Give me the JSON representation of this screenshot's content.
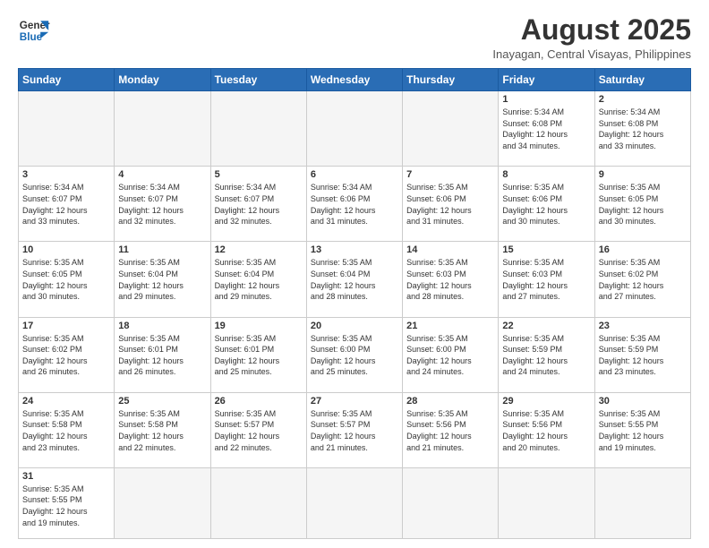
{
  "header": {
    "logo_general": "General",
    "logo_blue": "Blue",
    "month_year": "August 2025",
    "location": "Inayagan, Central Visayas, Philippines"
  },
  "weekdays": [
    "Sunday",
    "Monday",
    "Tuesday",
    "Wednesday",
    "Thursday",
    "Friday",
    "Saturday"
  ],
  "weeks": [
    [
      {
        "day": "",
        "info": ""
      },
      {
        "day": "",
        "info": ""
      },
      {
        "day": "",
        "info": ""
      },
      {
        "day": "",
        "info": ""
      },
      {
        "day": "",
        "info": ""
      },
      {
        "day": "1",
        "info": "Sunrise: 5:34 AM\nSunset: 6:08 PM\nDaylight: 12 hours\nand 34 minutes."
      },
      {
        "day": "2",
        "info": "Sunrise: 5:34 AM\nSunset: 6:08 PM\nDaylight: 12 hours\nand 33 minutes."
      }
    ],
    [
      {
        "day": "3",
        "info": "Sunrise: 5:34 AM\nSunset: 6:07 PM\nDaylight: 12 hours\nand 33 minutes."
      },
      {
        "day": "4",
        "info": "Sunrise: 5:34 AM\nSunset: 6:07 PM\nDaylight: 12 hours\nand 32 minutes."
      },
      {
        "day": "5",
        "info": "Sunrise: 5:34 AM\nSunset: 6:07 PM\nDaylight: 12 hours\nand 32 minutes."
      },
      {
        "day": "6",
        "info": "Sunrise: 5:34 AM\nSunset: 6:06 PM\nDaylight: 12 hours\nand 31 minutes."
      },
      {
        "day": "7",
        "info": "Sunrise: 5:35 AM\nSunset: 6:06 PM\nDaylight: 12 hours\nand 31 minutes."
      },
      {
        "day": "8",
        "info": "Sunrise: 5:35 AM\nSunset: 6:06 PM\nDaylight: 12 hours\nand 30 minutes."
      },
      {
        "day": "9",
        "info": "Sunrise: 5:35 AM\nSunset: 6:05 PM\nDaylight: 12 hours\nand 30 minutes."
      }
    ],
    [
      {
        "day": "10",
        "info": "Sunrise: 5:35 AM\nSunset: 6:05 PM\nDaylight: 12 hours\nand 30 minutes."
      },
      {
        "day": "11",
        "info": "Sunrise: 5:35 AM\nSunset: 6:04 PM\nDaylight: 12 hours\nand 29 minutes."
      },
      {
        "day": "12",
        "info": "Sunrise: 5:35 AM\nSunset: 6:04 PM\nDaylight: 12 hours\nand 29 minutes."
      },
      {
        "day": "13",
        "info": "Sunrise: 5:35 AM\nSunset: 6:04 PM\nDaylight: 12 hours\nand 28 minutes."
      },
      {
        "day": "14",
        "info": "Sunrise: 5:35 AM\nSunset: 6:03 PM\nDaylight: 12 hours\nand 28 minutes."
      },
      {
        "day": "15",
        "info": "Sunrise: 5:35 AM\nSunset: 6:03 PM\nDaylight: 12 hours\nand 27 minutes."
      },
      {
        "day": "16",
        "info": "Sunrise: 5:35 AM\nSunset: 6:02 PM\nDaylight: 12 hours\nand 27 minutes."
      }
    ],
    [
      {
        "day": "17",
        "info": "Sunrise: 5:35 AM\nSunset: 6:02 PM\nDaylight: 12 hours\nand 26 minutes."
      },
      {
        "day": "18",
        "info": "Sunrise: 5:35 AM\nSunset: 6:01 PM\nDaylight: 12 hours\nand 26 minutes."
      },
      {
        "day": "19",
        "info": "Sunrise: 5:35 AM\nSunset: 6:01 PM\nDaylight: 12 hours\nand 25 minutes."
      },
      {
        "day": "20",
        "info": "Sunrise: 5:35 AM\nSunset: 6:00 PM\nDaylight: 12 hours\nand 25 minutes."
      },
      {
        "day": "21",
        "info": "Sunrise: 5:35 AM\nSunset: 6:00 PM\nDaylight: 12 hours\nand 24 minutes."
      },
      {
        "day": "22",
        "info": "Sunrise: 5:35 AM\nSunset: 5:59 PM\nDaylight: 12 hours\nand 24 minutes."
      },
      {
        "day": "23",
        "info": "Sunrise: 5:35 AM\nSunset: 5:59 PM\nDaylight: 12 hours\nand 23 minutes."
      }
    ],
    [
      {
        "day": "24",
        "info": "Sunrise: 5:35 AM\nSunset: 5:58 PM\nDaylight: 12 hours\nand 23 minutes."
      },
      {
        "day": "25",
        "info": "Sunrise: 5:35 AM\nSunset: 5:58 PM\nDaylight: 12 hours\nand 22 minutes."
      },
      {
        "day": "26",
        "info": "Sunrise: 5:35 AM\nSunset: 5:57 PM\nDaylight: 12 hours\nand 22 minutes."
      },
      {
        "day": "27",
        "info": "Sunrise: 5:35 AM\nSunset: 5:57 PM\nDaylight: 12 hours\nand 21 minutes."
      },
      {
        "day": "28",
        "info": "Sunrise: 5:35 AM\nSunset: 5:56 PM\nDaylight: 12 hours\nand 21 minutes."
      },
      {
        "day": "29",
        "info": "Sunrise: 5:35 AM\nSunset: 5:56 PM\nDaylight: 12 hours\nand 20 minutes."
      },
      {
        "day": "30",
        "info": "Sunrise: 5:35 AM\nSunset: 5:55 PM\nDaylight: 12 hours\nand 19 minutes."
      }
    ],
    [
      {
        "day": "31",
        "info": "Sunrise: 5:35 AM\nSunset: 5:55 PM\nDaylight: 12 hours\nand 19 minutes."
      },
      {
        "day": "",
        "info": ""
      },
      {
        "day": "",
        "info": ""
      },
      {
        "day": "",
        "info": ""
      },
      {
        "day": "",
        "info": ""
      },
      {
        "day": "",
        "info": ""
      },
      {
        "day": "",
        "info": ""
      }
    ]
  ]
}
